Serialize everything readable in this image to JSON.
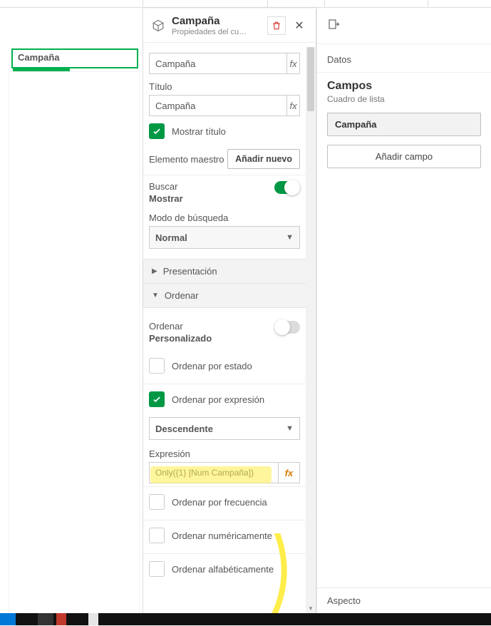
{
  "canvas": {
    "listbox_title": "Campaña"
  },
  "panel": {
    "title": "Campaña",
    "subtitle": "Propiedades del cu…",
    "field_input": "Campaña",
    "title_label": "Título",
    "title_input": "Campaña",
    "show_title_label": "Mostrar título",
    "master_label": "Elemento maestro",
    "add_new_btn": "Añadir nuevo",
    "search_label": "Buscar",
    "search_value": "Mostrar",
    "search_mode_label": "Modo de búsqueda",
    "search_mode_value": "Normal",
    "presentation_section": "Presentación",
    "sort_section": "Ordenar",
    "sort_label": "Ordenar",
    "sort_value": "Personalizado",
    "sort_by_state": "Ordenar por estado",
    "sort_by_expression": "Ordenar por expresión",
    "sort_direction": "Descendente",
    "expression_label": "Expresión",
    "expression_value": "Only({1} [Num Campaña])",
    "sort_by_frequency": "Ordenar por frecuencia",
    "sort_numeric": "Ordenar numéricamente",
    "sort_alpha": "Ordenar alfabéticamente"
  },
  "right": {
    "data_tab": "Datos",
    "fields_heading": "Campos",
    "fields_sub": "Cuadro de lista",
    "field_chip": "Campaña",
    "add_field_btn": "Añadir campo",
    "aspect_tab": "Aspecto"
  }
}
